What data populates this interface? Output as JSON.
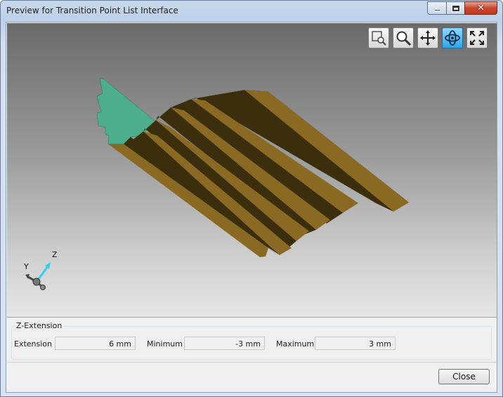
{
  "window": {
    "title": "Preview for Transition Point List Interface"
  },
  "titlebar_controls": {
    "minimize_icon": "minimize-icon",
    "maximize_icon": "maximize-icon",
    "close_glyph": "✕"
  },
  "view_toolbar": [
    {
      "name": "zoom-window-button",
      "icon": "zoom-window-icon",
      "active": false
    },
    {
      "name": "zoom-button",
      "icon": "magnifier-icon",
      "active": false
    },
    {
      "name": "pan-button",
      "icon": "pan-arrows-icon",
      "active": false
    },
    {
      "name": "rotate-button",
      "icon": "rotate-orbit-icon",
      "active": true
    },
    {
      "name": "fit-all-button",
      "icon": "fit-all-icon",
      "active": false
    }
  ],
  "axis_triad": {
    "z_label": "Z",
    "y_label": "Y"
  },
  "z_extension": {
    "title": "Z-Extension",
    "extension_label": "Extension",
    "extension_value": "6 mm",
    "minimum_label": "Minimum",
    "minimum_value": "-3 mm",
    "maximum_label": "Maximum",
    "maximum_value": "3 mm"
  },
  "buttons": {
    "close_label": "Close"
  },
  "colors": {
    "face_light": "#8a6a22",
    "face_dark": "#3a2e0c",
    "end_cap": "#4dae8e",
    "active_tool": "#2aa6e8"
  }
}
